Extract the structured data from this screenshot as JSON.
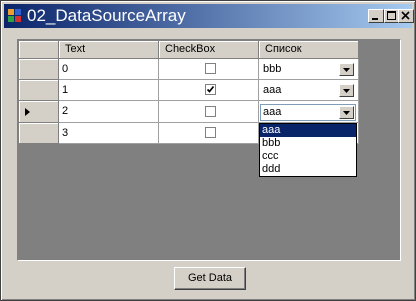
{
  "window": {
    "title": "02_DataSourceArray",
    "icon": "form-app-icon",
    "controls": [
      "minimize-icon",
      "maximize-icon",
      "close-icon"
    ]
  },
  "grid": {
    "columns": [
      "Text",
      "CheckBox",
      "Список"
    ],
    "rows": [
      {
        "text": "0",
        "checked": false,
        "combo": "bbb"
      },
      {
        "text": "1",
        "checked": true,
        "combo": "aaa"
      },
      {
        "text": "2",
        "checked": false,
        "combo": "aaa",
        "current": true
      },
      {
        "text": "3",
        "checked": false,
        "combo": ""
      }
    ]
  },
  "dropdown": {
    "options": [
      "aaa",
      "bbb",
      "ccc",
      "ddd"
    ],
    "selected": "aaa"
  },
  "button": {
    "label": "Get Data"
  },
  "colors": {
    "title_start": "#0a246a",
    "title_end": "#a6caf0",
    "face": "#d4d0c8",
    "grid_background": "#808080",
    "selection": "#0a246a"
  }
}
